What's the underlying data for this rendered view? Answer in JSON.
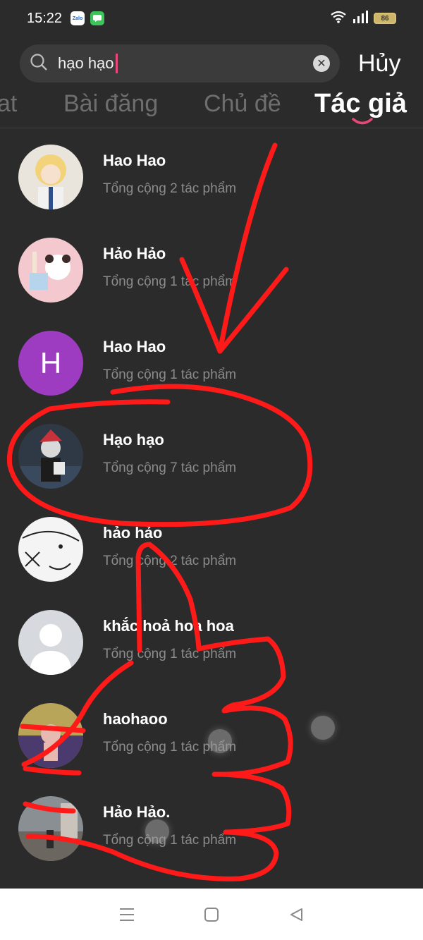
{
  "status_bar": {
    "time": "15:22",
    "zalo_label": "Zalo",
    "battery": "86"
  },
  "search": {
    "value": "hạo hạo",
    "cancel_label": "Hủy"
  },
  "tabs": [
    {
      "label": "at"
    },
    {
      "label": "Bài đăng"
    },
    {
      "label": "Chủ đề"
    },
    {
      "label": "Tác giả"
    }
  ],
  "results": [
    {
      "name": "Hao Hao",
      "subtitle": "Tổng cộng 2 tác phẩm"
    },
    {
      "name": "Hảo Hảo",
      "subtitle": "Tổng cộng 1 tác phẩm"
    },
    {
      "name": "Hao Hao",
      "subtitle": "Tổng cộng 1 tác phẩm",
      "avatar_letter": "H"
    },
    {
      "name": "Hạo hạo",
      "subtitle": "Tổng cộng 7 tác phẩm"
    },
    {
      "name": "hảo hảo",
      "subtitle": "Tổng cộng 2 tác phẩm"
    },
    {
      "name": "khắc hoả hoa hoa",
      "subtitle": "Tổng cộng 1 tác phẩm"
    },
    {
      "name": "haohaoo",
      "subtitle": "Tổng cộng 1 tác phẩm"
    },
    {
      "name": "Hảo Hảo.",
      "subtitle": "Tổng cộng 1 tác phẩm"
    }
  ],
  "colors": {
    "background": "#2b2b2b",
    "accent_pink": "#e8487a",
    "annotation_red": "#ff1a1a",
    "avatar_purple": "#9d3cc1"
  }
}
